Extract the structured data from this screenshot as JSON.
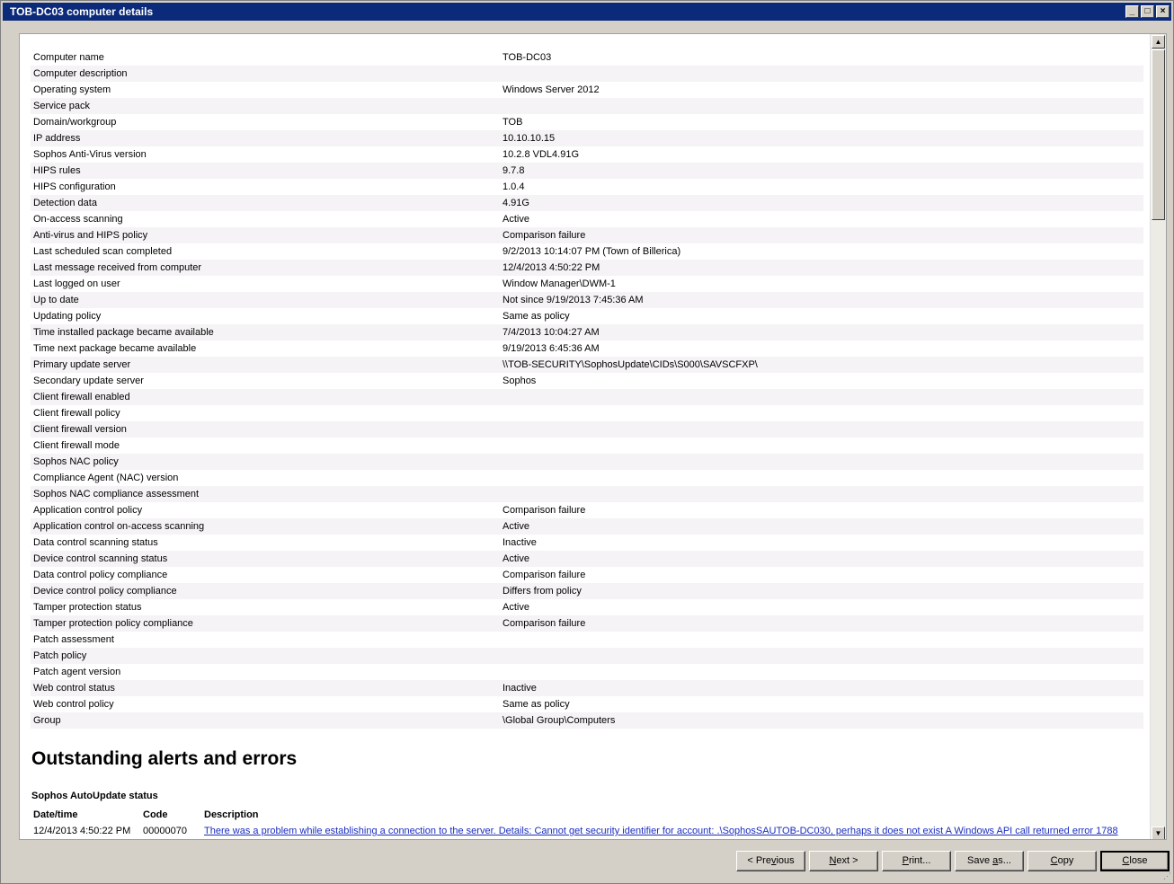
{
  "window": {
    "title": "TOB-DC03 computer details",
    "minimize_glyph": "_",
    "maximize_glyph": "□",
    "close_glyph": "×"
  },
  "details": [
    {
      "label": "Computer name",
      "value": "TOB-DC03"
    },
    {
      "label": "Computer description",
      "value": ""
    },
    {
      "label": "Operating system",
      "value": "Windows Server 2012"
    },
    {
      "label": "Service pack",
      "value": ""
    },
    {
      "label": "Domain/workgroup",
      "value": "TOB"
    },
    {
      "label": "IP address",
      "value": "10.10.10.15"
    },
    {
      "label": "Sophos Anti-Virus version",
      "value": "10.2.8 VDL4.91G"
    },
    {
      "label": "HIPS rules",
      "value": "9.7.8"
    },
    {
      "label": "HIPS configuration",
      "value": "1.0.4"
    },
    {
      "label": "Detection data",
      "value": "4.91G"
    },
    {
      "label": "On-access scanning",
      "value": "Active"
    },
    {
      "label": "Anti-virus and HIPS policy",
      "value": "Comparison failure"
    },
    {
      "label": "Last scheduled scan completed",
      "value": "9/2/2013 10:14:07 PM (Town of Billerica)"
    },
    {
      "label": "Last message received from computer",
      "value": "12/4/2013 4:50:22 PM"
    },
    {
      "label": "Last logged on user",
      "value": "Window Manager\\DWM-1"
    },
    {
      "label": "Up to date",
      "value": "Not since 9/19/2013 7:45:36 AM"
    },
    {
      "label": "Updating policy",
      "value": "Same as policy"
    },
    {
      "label": "Time installed package became available",
      "value": "7/4/2013 10:04:27 AM"
    },
    {
      "label": "Time next package became available",
      "value": "9/19/2013 6:45:36 AM"
    },
    {
      "label": "Primary update server",
      "value": "\\\\TOB-SECURITY\\SophosUpdate\\CIDs\\S000\\SAVSCFXP\\"
    },
    {
      "label": "Secondary update server",
      "value": "Sophos"
    },
    {
      "label": "Client firewall enabled",
      "value": ""
    },
    {
      "label": "Client firewall policy",
      "value": ""
    },
    {
      "label": "Client firewall version",
      "value": ""
    },
    {
      "label": "Client firewall mode",
      "value": ""
    },
    {
      "label": "Sophos NAC policy",
      "value": ""
    },
    {
      "label": "Compliance Agent (NAC) version",
      "value": ""
    },
    {
      "label": "Sophos NAC compliance assessment",
      "value": ""
    },
    {
      "label": "Application control policy",
      "value": "Comparison failure"
    },
    {
      "label": "Application control on-access scanning",
      "value": "Active"
    },
    {
      "label": "Data control scanning status",
      "value": "Inactive"
    },
    {
      "label": "Device control scanning status",
      "value": "Active"
    },
    {
      "label": "Data control policy compliance",
      "value": "Comparison failure"
    },
    {
      "label": "Device control policy compliance",
      "value": "Differs from policy"
    },
    {
      "label": "Tamper protection status",
      "value": "Active"
    },
    {
      "label": "Tamper protection policy compliance",
      "value": "Comparison failure"
    },
    {
      "label": "Patch assessment",
      "value": ""
    },
    {
      "label": "Patch policy",
      "value": ""
    },
    {
      "label": "Patch agent version",
      "value": ""
    },
    {
      "label": "Web control status",
      "value": "Inactive"
    },
    {
      "label": "Web control policy",
      "value": "Same as policy"
    },
    {
      "label": "Group",
      "value": "\\Global Group\\Computers"
    }
  ],
  "alerts": {
    "title": "Outstanding alerts and errors",
    "section": "Sophos AutoUpdate status",
    "headers": {
      "datetime": "Date/time",
      "code": "Code",
      "description": "Description"
    },
    "rows": [
      {
        "datetime": "12/4/2013 4:50:22 PM",
        "code": "00000070",
        "description": "There was a problem while establishing a connection to the server. Details: Cannot get security identifier for account: .\\SophosSAUTOB-DC030, perhaps it does not exist A Windows API call returned error 1788"
      }
    ]
  },
  "scrollbar": {
    "up_glyph": "▲",
    "down_glyph": "▼"
  },
  "buttons": {
    "previous": {
      "pre": "< Pre",
      "u": "v",
      "post": "ious"
    },
    "next": {
      "pre": "",
      "u": "N",
      "post": "ext >"
    },
    "print": {
      "pre": "",
      "u": "P",
      "post": "rint..."
    },
    "saveas": {
      "pre": "Save ",
      "u": "a",
      "post": "s..."
    },
    "copy": {
      "pre": "",
      "u": "C",
      "post": "opy"
    },
    "close": {
      "pre": "",
      "u": "C",
      "post": "lose"
    }
  }
}
